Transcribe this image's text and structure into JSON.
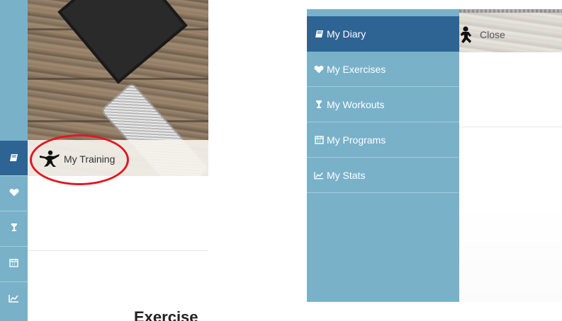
{
  "left": {
    "sidebar_icons": [
      "book-icon",
      "heart-icon",
      "trophy-icon",
      "calendar-icon",
      "chart-icon"
    ],
    "banner_label": "My Training",
    "heading": "Exercise"
  },
  "right": {
    "close_label": "Close",
    "menu": [
      {
        "label": "My Diary",
        "icon": "book-icon",
        "active": true
      },
      {
        "label": "My Exercises",
        "icon": "heart-icon",
        "active": false
      },
      {
        "label": "My Workouts",
        "icon": "trophy-icon",
        "active": false
      },
      {
        "label": "My Programs",
        "icon": "calendar-icon",
        "active": false
      },
      {
        "label": "My Stats",
        "icon": "chart-icon",
        "active": false
      }
    ]
  },
  "colors": {
    "sidebar": "#79b1c9",
    "active": "#2d6493",
    "highlight_ring": "#e0191f"
  }
}
